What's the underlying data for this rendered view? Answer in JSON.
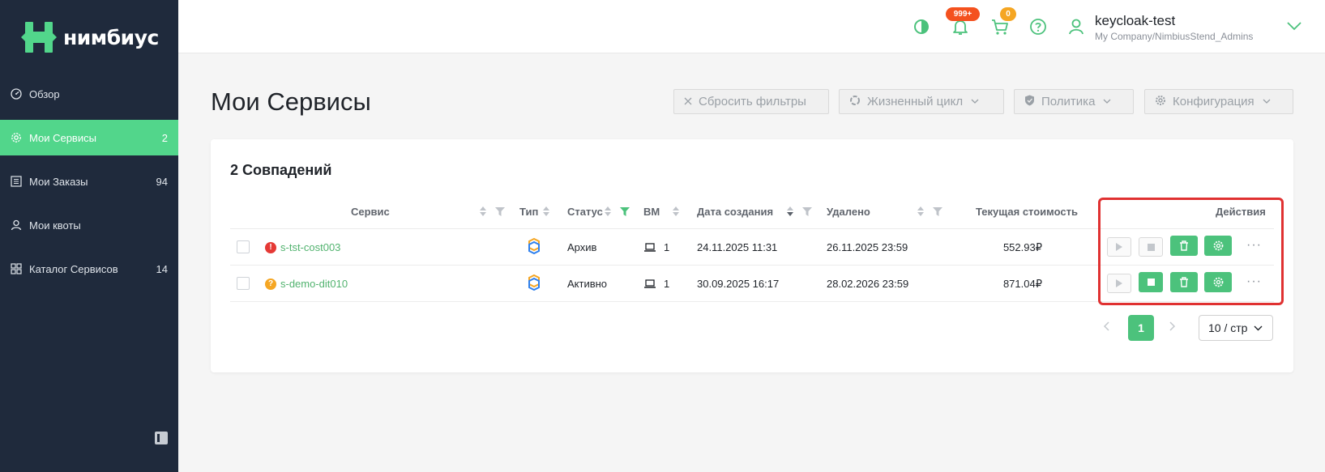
{
  "app": {
    "logo_text": "нимбиус"
  },
  "sidebar": {
    "items": [
      {
        "label": "Обзор",
        "count": ""
      },
      {
        "label": "Мои Сервисы",
        "count": "2"
      },
      {
        "label": "Мои Заказы",
        "count": "94"
      },
      {
        "label": "Мои квоты",
        "count": ""
      },
      {
        "label": "Каталог Сервисов",
        "count": "14"
      }
    ]
  },
  "header": {
    "notifications_badge": "999+",
    "cart_badge": "0",
    "user_name": "keycloak-test",
    "user_org": "My Company/NimbiusStend_Admins"
  },
  "page": {
    "title": "Мои Сервисы",
    "filters": {
      "reset": "Сбросить фильтры",
      "lifecycle": "Жизненный цикл",
      "policy": "Политика",
      "config": "Конфигурация"
    }
  },
  "table": {
    "matches": "2 Совпадений",
    "columns": {
      "service": "Сервис",
      "type": "Тип",
      "status": "Статус",
      "vm": "ВМ",
      "created": "Дата создания",
      "deleted": "Удалено",
      "cost": "Текущая стоимость",
      "actions": "Действия"
    },
    "rows": [
      {
        "service": "s-tst-cost003",
        "status_icon": "!",
        "status": "Архив",
        "vm": "1",
        "created": "24.11.2025 11:31",
        "deleted": "26.11.2025 23:59",
        "cost": "552.93₽"
      },
      {
        "service": "s-demo-dit010",
        "status_icon": "?",
        "status": "Активно",
        "vm": "1",
        "created": "30.09.2025 16:17",
        "deleted": "28.02.2026 23:59",
        "cost": "871.04₽"
      }
    ],
    "more": "···"
  },
  "pagination": {
    "current": "1",
    "page_size": "10 / стр"
  },
  "colors": {
    "accent": "#4cc27c",
    "sidebar_bg": "#1f2a3c",
    "link": "#52b36f",
    "error": "#e53935",
    "warning": "#f5a623",
    "badge": "#f4511e",
    "cart_badge": "#f5a623"
  }
}
